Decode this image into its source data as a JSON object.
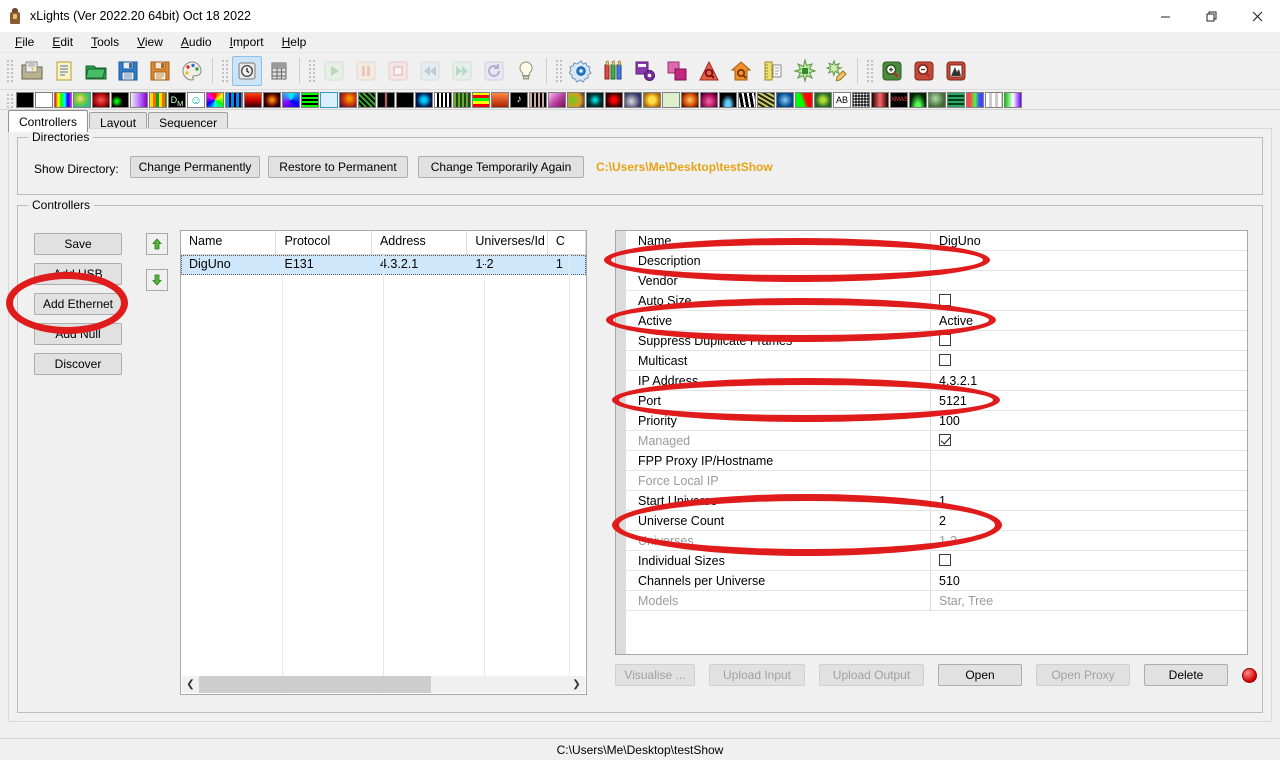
{
  "window": {
    "title": "xLights (Ver 2022.20 64bit) Oct 18 2022",
    "app_icon": "xlights-icon",
    "minimize": "minimize-icon",
    "maximize": "restore-icon",
    "close": "close-icon"
  },
  "menu": [
    {
      "label": "File",
      "mnemonic": "F"
    },
    {
      "label": "Edit",
      "mnemonic": "E"
    },
    {
      "label": "Tools",
      "mnemonic": "T"
    },
    {
      "label": "View",
      "mnemonic": "V"
    },
    {
      "label": "Audio",
      "mnemonic": "A"
    },
    {
      "label": "Import",
      "mnemonic": "I"
    },
    {
      "label": "Help",
      "mnemonic": "H"
    }
  ],
  "toolbar": {
    "groups": [
      {
        "name": "file-toolbar",
        "buttons": [
          {
            "icon": "open-show-folder-icon",
            "enabled": true
          },
          {
            "icon": "new-sequence-icon",
            "enabled": true
          },
          {
            "icon": "open-sequence-icon",
            "enabled": true
          },
          {
            "icon": "save-icon",
            "enabled": true
          },
          {
            "icon": "save-as-icon",
            "enabled": true
          },
          {
            "icon": "color-palette-icon",
            "enabled": true
          }
        ]
      },
      {
        "name": "render-toolbar",
        "buttons": [
          {
            "icon": "render-all-icon",
            "enabled": true,
            "active": true
          },
          {
            "icon": "grid-icon",
            "enabled": true
          }
        ]
      },
      {
        "name": "playback-toolbar",
        "buttons": [
          {
            "icon": "play-icon",
            "enabled": false
          },
          {
            "icon": "pause-icon",
            "enabled": false
          },
          {
            "icon": "stop-icon",
            "enabled": false
          },
          {
            "icon": "rewind-icon",
            "enabled": false
          },
          {
            "icon": "fast-forward-icon",
            "enabled": false
          },
          {
            "icon": "replay-icon",
            "enabled": false
          },
          {
            "icon": "lightbulb-icon",
            "enabled": true
          }
        ]
      },
      {
        "name": "edit-toolbar",
        "buttons": [
          {
            "icon": "setup-gear-icon",
            "enabled": true
          },
          {
            "icon": "crayons-icon",
            "enabled": true
          },
          {
            "icon": "model-settings-icon",
            "enabled": true
          },
          {
            "icon": "layers-icon",
            "enabled": true
          },
          {
            "icon": "preview-icon",
            "enabled": true
          },
          {
            "icon": "house-preview-icon",
            "enabled": true
          },
          {
            "icon": "ruler-icon",
            "enabled": true
          },
          {
            "icon": "effects-icon",
            "enabled": true
          },
          {
            "icon": "edit-effects-icon",
            "enabled": true
          }
        ]
      },
      {
        "name": "zoom-toolbar",
        "buttons": [
          {
            "icon": "zoom-in-icon",
            "enabled": true
          },
          {
            "icon": "zoom-out-icon",
            "enabled": true
          },
          {
            "icon": "zoom-fit-icon",
            "enabled": true
          }
        ]
      }
    ],
    "palette_label": "effect-preset-strip"
  },
  "tabs": [
    {
      "label": "Controllers",
      "selected": true
    },
    {
      "label": "Layout",
      "selected": false
    },
    {
      "label": "Sequencer",
      "selected": false
    }
  ],
  "directories": {
    "legend": "Directories",
    "show_directory_label": "Show Directory:",
    "change_permanently": "Change Permanently",
    "restore_to_permanent": "Restore to Permanent",
    "change_temporarily_again": "Change Temporarily Again",
    "path": "C:\\Users\\Me\\Desktop\\testShow",
    "path_color": "#e8a317"
  },
  "controllers": {
    "legend": "Controllers",
    "buttons": [
      {
        "label": "Save",
        "enabled": true
      },
      {
        "label": "Add USB",
        "enabled": true
      },
      {
        "label": "Add Ethernet",
        "enabled": true
      },
      {
        "label": "Add Null",
        "enabled": true
      },
      {
        "label": "Discover",
        "enabled": true
      }
    ],
    "reorder": [
      {
        "icon": "move-up-arrow-icon"
      },
      {
        "icon": "move-down-arrow-icon"
      }
    ],
    "list": {
      "columns": [
        "Name",
        "Protocol",
        "Address",
        "Universes/Id",
        "C"
      ],
      "rows": [
        {
          "cells": [
            "DigUno",
            "E131",
            "4.3.2.1",
            "1-2",
            "1"
          ],
          "selected": true
        }
      ]
    }
  },
  "properties": [
    {
      "name": "Name",
      "value": "DigUno",
      "type": "text",
      "dim": false
    },
    {
      "name": "Description",
      "value": "",
      "type": "text",
      "dim": false
    },
    {
      "name": "Vendor",
      "value": "",
      "type": "text",
      "dim": false
    },
    {
      "name": "Auto Size",
      "value": "",
      "type": "checkbox",
      "checked": false,
      "dim": false
    },
    {
      "name": "Active",
      "value": "Active",
      "type": "text",
      "dim": false
    },
    {
      "name": "Suppress Duplicate Frames",
      "value": "",
      "type": "checkbox",
      "checked": false,
      "dim": false
    },
    {
      "name": "Multicast",
      "value": "",
      "type": "checkbox",
      "checked": false,
      "dim": false
    },
    {
      "name": "IP Address",
      "value": "4.3.2.1",
      "type": "text",
      "dim": false
    },
    {
      "name": "Port",
      "value": "5121",
      "type": "text",
      "dim": false
    },
    {
      "name": "Priority",
      "value": "100",
      "type": "text",
      "dim": false
    },
    {
      "name": "Managed",
      "value": "",
      "type": "checkbox",
      "checked": true,
      "dim": true
    },
    {
      "name": "FPP Proxy IP/Hostname",
      "value": "",
      "type": "text",
      "dim": false
    },
    {
      "name": "Force Local IP",
      "value": "",
      "type": "text",
      "dim": true
    },
    {
      "name": "Start Universe",
      "value": "1",
      "type": "text",
      "dim": false
    },
    {
      "name": "Universe Count",
      "value": "2",
      "type": "text",
      "dim": false
    },
    {
      "name": "Universes",
      "value": "1-2",
      "type": "text",
      "dim": true
    },
    {
      "name": "Individual Sizes",
      "value": "",
      "type": "checkbox",
      "checked": false,
      "dim": false
    },
    {
      "name": "Channels per Universe",
      "value": "510",
      "type": "text",
      "dim": false
    },
    {
      "name": "Models",
      "value": "Star, Tree",
      "type": "text",
      "dim": true
    }
  ],
  "actions": [
    {
      "label": "Visualise ...",
      "enabled": false
    },
    {
      "label": "Upload Input",
      "enabled": false
    },
    {
      "label": "Upload Output",
      "enabled": false
    },
    {
      "label": "Open",
      "enabled": true
    },
    {
      "label": "Open Proxy",
      "enabled": false
    },
    {
      "label": "Delete",
      "enabled": true
    }
  ],
  "status_indicator": "red-status-ball-icon",
  "statusbar": {
    "text": "C:\\Users\\Me\\Desktop\\testShow"
  },
  "annotations": {
    "color": "#e01b1b",
    "ellipses": [
      {
        "name": "annotation-add-ethernet"
      },
      {
        "name": "annotation-name-row"
      },
      {
        "name": "annotation-auto-size-row"
      },
      {
        "name": "annotation-ip-address-row"
      },
      {
        "name": "annotation-universe-rows"
      }
    ]
  }
}
